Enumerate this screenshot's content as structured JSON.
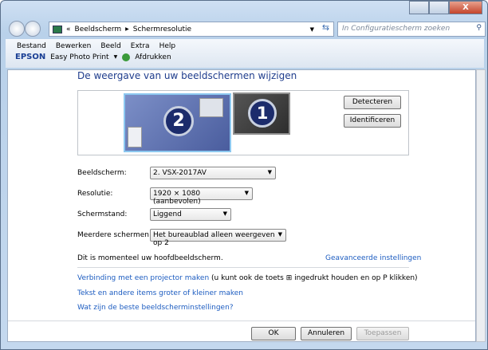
{
  "window": {
    "buttons": [
      "minimize",
      "maximize",
      "close"
    ],
    "close_glyph": "X"
  },
  "address": {
    "prefix": "«",
    "crumbs": [
      "Beeldscherm",
      "Schermresolutie"
    ],
    "search_placeholder": "In Configuratiescherm zoeken"
  },
  "menu": [
    {
      "label": "Bestand",
      "key": "B"
    },
    {
      "label": "Bewerken",
      "key": "w"
    },
    {
      "label": "Beeld",
      "key": "l"
    },
    {
      "label": "Extra",
      "key": "x"
    },
    {
      "label": "Help",
      "key": "H"
    }
  ],
  "epson": {
    "logo": "EPSON",
    "app": "Easy Photo Print",
    "print": "Afdrukken"
  },
  "main": {
    "title": "De weergave van uw beeldschermen wijzigen",
    "monitors": [
      {
        "number": "2",
        "selected": true
      },
      {
        "number": "1",
        "selected": false
      }
    ],
    "detect": "Detecteren",
    "identify": "Identificeren",
    "fields": [
      {
        "label": "Beeldscherm:",
        "value": "2. VSX-2017AV"
      },
      {
        "label": "Resolutie:",
        "value": "1920 × 1080 (aanbevolen)"
      },
      {
        "label": "Schermstand:",
        "value": "Liggend"
      },
      {
        "label": "Meerdere schermen:",
        "value": "Het bureaublad alleen weergeven op 2"
      }
    ],
    "primary_note": "Dit is momenteel uw hoofdbeeldscherm.",
    "advanced": "Geavanceerde instellingen",
    "projector_link": "Verbinding met een projector maken",
    "projector_note_a": "(u kunt ook de toets",
    "projector_note_b": "ingedrukt houden en op P klikken)",
    "text_size_link": "Tekst en andere items groter of kleiner maken",
    "best_link": "Wat zijn de beste beeldscherminstellingen?",
    "ok": "OK",
    "cancel": "Annuleren",
    "apply": "Toepassen"
  },
  "colors": {
    "link": "#1c5cc0",
    "title": "#1e3c8c",
    "selected_monitor": "#5a6db0"
  }
}
